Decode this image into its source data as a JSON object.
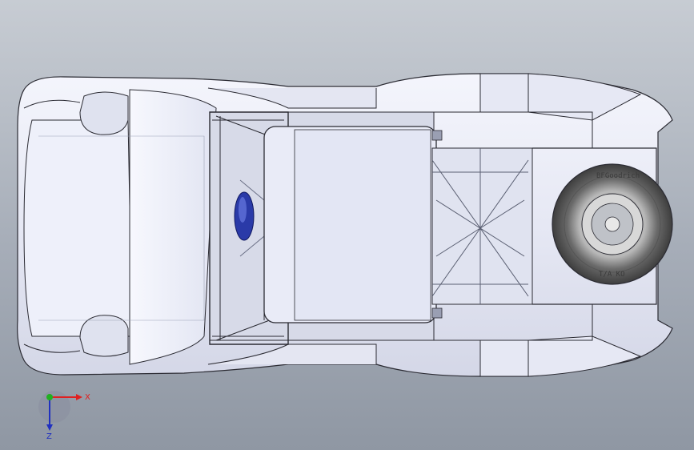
{
  "app": {
    "view": "top",
    "type": "3d-cad-viewport"
  },
  "colors": {
    "background_top": "#c7ccd3",
    "background_bottom": "#8f97a3",
    "body": "#ebedf7",
    "body_shade": "#c9ccdb",
    "edge": "#2b2b33",
    "tire": "#4a4a4a",
    "seat": "#2a3aa8",
    "x_axis": "#e02020",
    "y_axis": "#20b020",
    "z_axis": "#2030c0"
  },
  "model": {
    "parts": [
      "body-shell",
      "nose",
      "hood",
      "roll-cage",
      "seat",
      "spare-tire",
      "rear-frame"
    ]
  },
  "spare_tire": {
    "sidewall_text_1": "BFGoodrich",
    "sidewall_text_2": "T/A KO"
  },
  "triad": {
    "x_label": "X",
    "z_label": "Z",
    "icons": [
      "x-axis-arrow-icon",
      "y-axis-arrow-icon",
      "z-axis-arrow-icon"
    ]
  }
}
